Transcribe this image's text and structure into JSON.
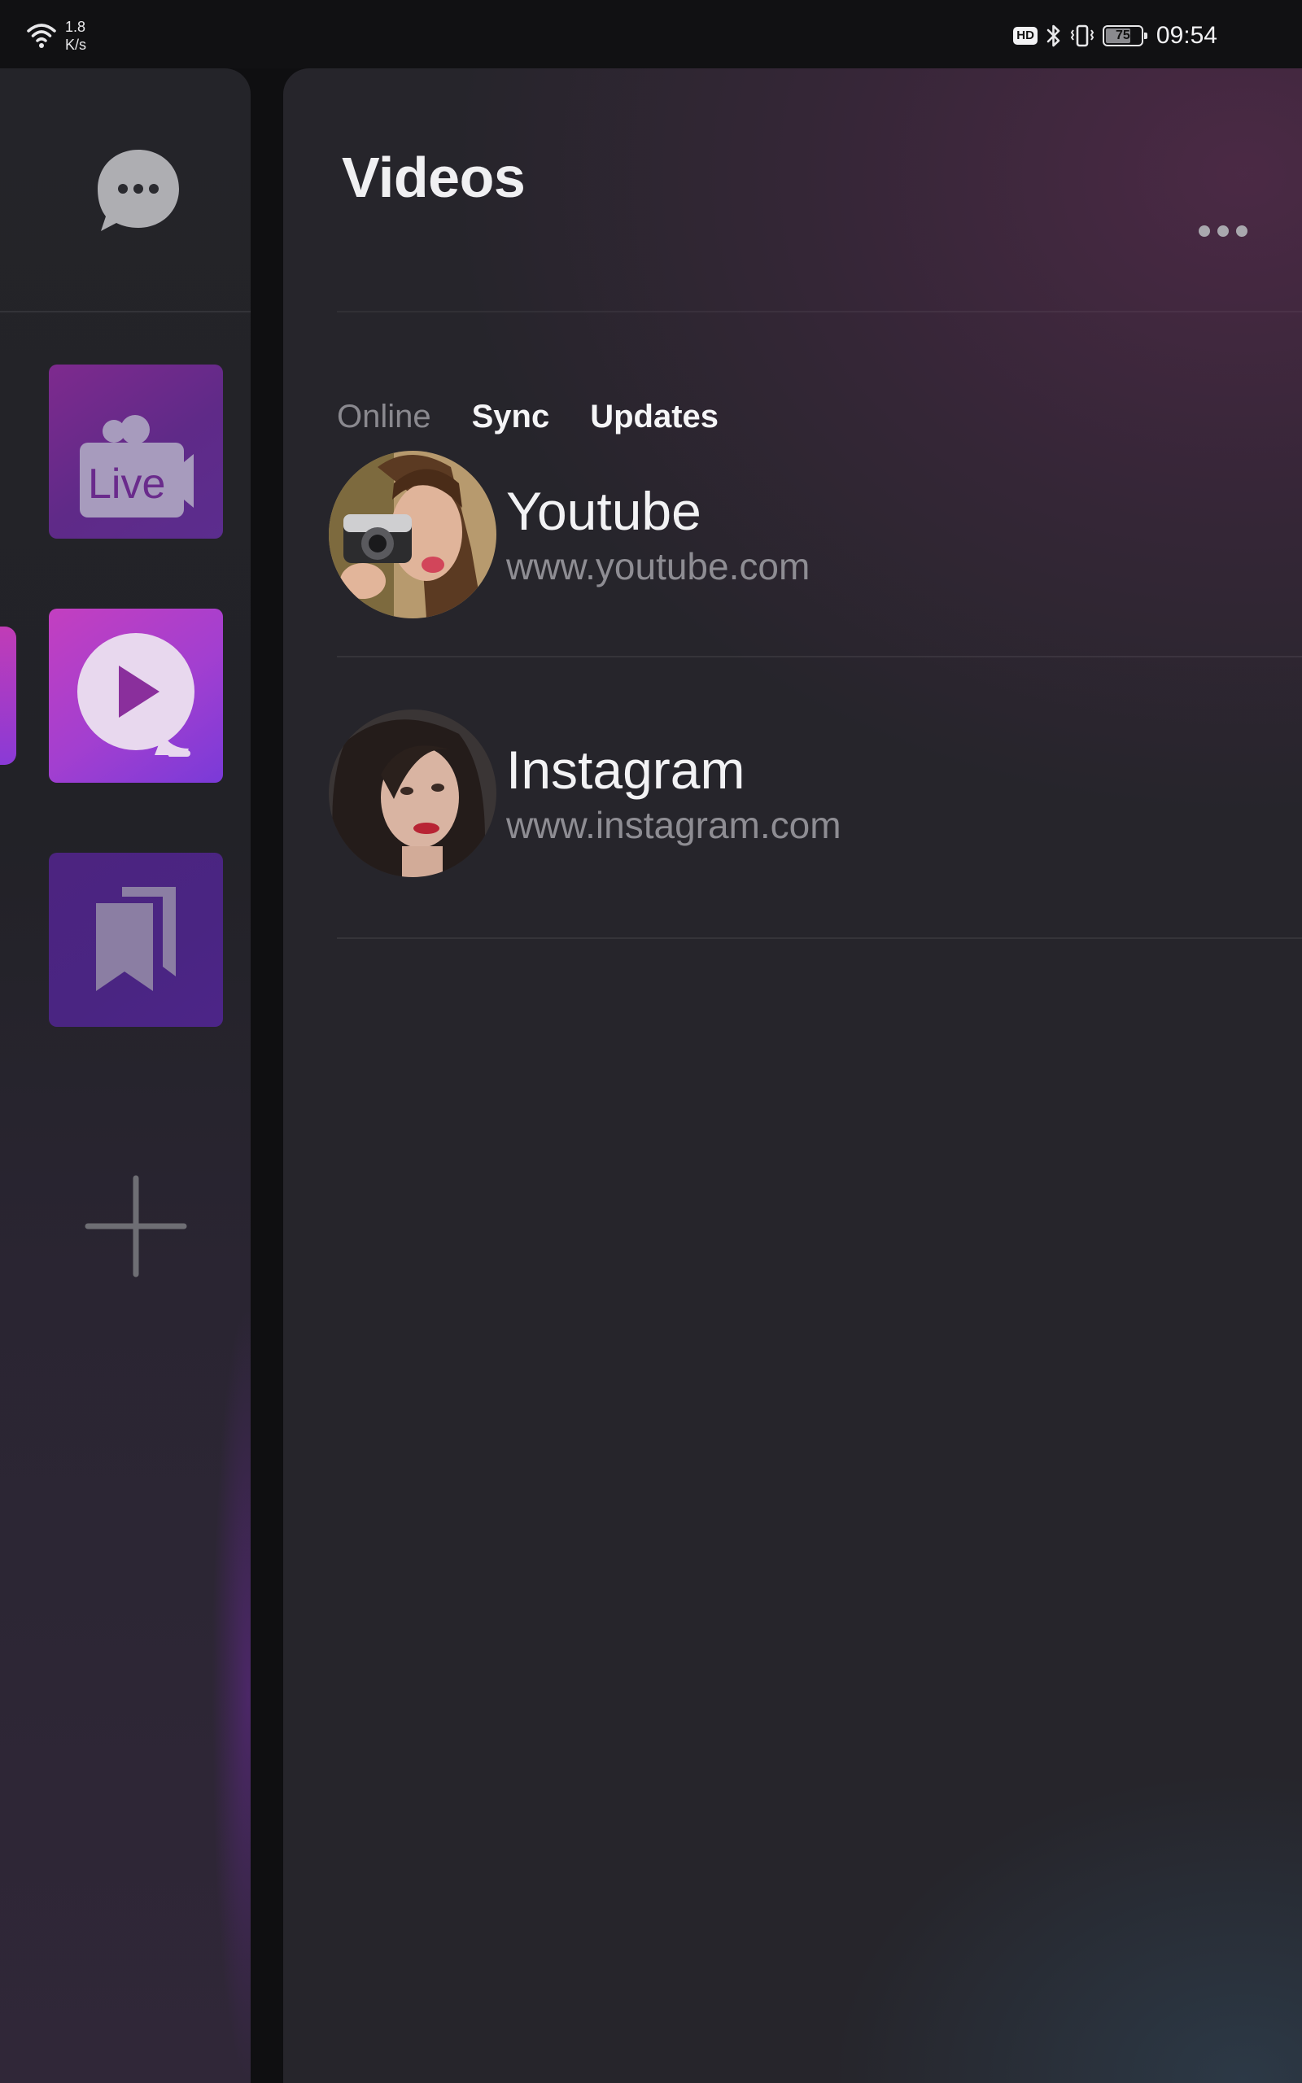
{
  "status_bar": {
    "net_speed_value": "1.8",
    "net_speed_unit": "K/s",
    "hd_label": "HD",
    "battery_level": "75",
    "battery_percent": 75,
    "time": "09:54"
  },
  "sidebar": {
    "chat_icon": "chat-bubble-icon",
    "tiles": [
      {
        "name": "live",
        "label": "Live",
        "icon": "video-camera-icon"
      },
      {
        "name": "video-player",
        "icon": "play-icon",
        "active": true
      },
      {
        "name": "bookmarks",
        "icon": "bookmarks-icon"
      }
    ],
    "add_icon": "plus-icon"
  },
  "main": {
    "title": "Videos",
    "more_icon": "more-horizontal-icon",
    "tabs": [
      {
        "label": "Online",
        "active": false
      },
      {
        "label": "Sync",
        "active": true
      },
      {
        "label": "Updates",
        "active": true
      }
    ],
    "sites": [
      {
        "name": "Youtube",
        "url": "www.youtube.com"
      },
      {
        "name": "Instagram",
        "url": "www.instagram.com"
      }
    ]
  },
  "colors": {
    "background": "#0f0f11",
    "panel": "#26252b",
    "accent_magenta": "#c33fc0",
    "accent_purple": "#7a3ad8",
    "text_primary": "#f2f2f4",
    "text_secondary": "#8e8d93"
  }
}
